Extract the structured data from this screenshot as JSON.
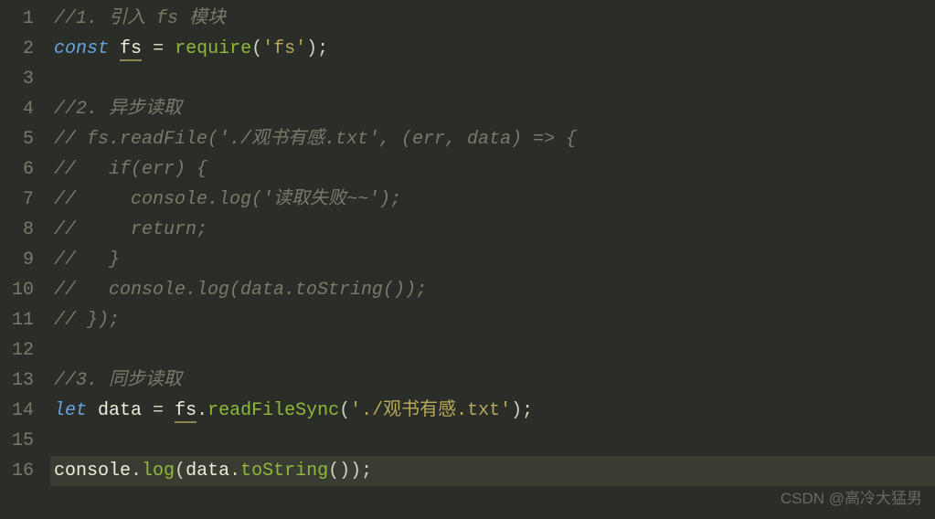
{
  "lines": [
    {
      "num": "1",
      "highlighted": false,
      "tokens": [
        {
          "cls": "tk-comment",
          "t": "//1. 引入 fs 模块"
        }
      ]
    },
    {
      "num": "2",
      "highlighted": false,
      "tokens": [
        {
          "cls": "tk-keyword",
          "t": "const"
        },
        {
          "cls": "tk-default",
          "t": " "
        },
        {
          "cls": "tk-var tk-warn",
          "t": "fs"
        },
        {
          "cls": "tk-default",
          "t": " "
        },
        {
          "cls": "tk-punct",
          "t": "="
        },
        {
          "cls": "tk-default",
          "t": " "
        },
        {
          "cls": "tk-func",
          "t": "require"
        },
        {
          "cls": "tk-punct",
          "t": "("
        },
        {
          "cls": "tk-string",
          "t": "'fs'"
        },
        {
          "cls": "tk-punct",
          "t": ");"
        }
      ]
    },
    {
      "num": "3",
      "highlighted": false,
      "tokens": []
    },
    {
      "num": "4",
      "highlighted": false,
      "tokens": [
        {
          "cls": "tk-comment",
          "t": "//2. 异步读取"
        }
      ]
    },
    {
      "num": "5",
      "highlighted": false,
      "tokens": [
        {
          "cls": "tk-comment",
          "t": "// fs.readFile('./观书有感.txt', (err, data) => {"
        }
      ]
    },
    {
      "num": "6",
      "highlighted": false,
      "tokens": [
        {
          "cls": "tk-comment",
          "t": "//   if(err) {"
        }
      ]
    },
    {
      "num": "7",
      "highlighted": false,
      "tokens": [
        {
          "cls": "tk-comment",
          "t": "//     console.log('读取失败~~');"
        }
      ]
    },
    {
      "num": "8",
      "highlighted": false,
      "tokens": [
        {
          "cls": "tk-comment",
          "t": "//     return;"
        }
      ]
    },
    {
      "num": "9",
      "highlighted": false,
      "tokens": [
        {
          "cls": "tk-comment",
          "t": "//   }"
        }
      ]
    },
    {
      "num": "10",
      "highlighted": false,
      "tokens": [
        {
          "cls": "tk-comment",
          "t": "//   console.log(data.toString());"
        }
      ]
    },
    {
      "num": "11",
      "highlighted": false,
      "tokens": [
        {
          "cls": "tk-comment",
          "t": "// });"
        }
      ]
    },
    {
      "num": "12",
      "highlighted": false,
      "tokens": []
    },
    {
      "num": "13",
      "highlighted": false,
      "tokens": [
        {
          "cls": "tk-comment",
          "t": "//3. 同步读取"
        }
      ]
    },
    {
      "num": "14",
      "highlighted": false,
      "tokens": [
        {
          "cls": "tk-keyword",
          "t": "let"
        },
        {
          "cls": "tk-default",
          "t": " data "
        },
        {
          "cls": "tk-punct",
          "t": "="
        },
        {
          "cls": "tk-default",
          "t": " "
        },
        {
          "cls": "tk-var tk-warn",
          "t": "fs"
        },
        {
          "cls": "tk-punct",
          "t": "."
        },
        {
          "cls": "tk-method",
          "t": "readFileSync"
        },
        {
          "cls": "tk-punct",
          "t": "("
        },
        {
          "cls": "tk-string",
          "t": "'./观书有感.txt'"
        },
        {
          "cls": "tk-punct",
          "t": ");"
        }
      ]
    },
    {
      "num": "15",
      "highlighted": false,
      "tokens": []
    },
    {
      "num": "16",
      "highlighted": true,
      "tokens": [
        {
          "cls": "tk-default",
          "t": "console"
        },
        {
          "cls": "tk-punct",
          "t": "."
        },
        {
          "cls": "tk-method",
          "t": "log"
        },
        {
          "cls": "tk-punct",
          "t": "("
        },
        {
          "cls": "tk-default",
          "t": "data"
        },
        {
          "cls": "tk-punct",
          "t": "."
        },
        {
          "cls": "tk-method",
          "t": "toString"
        },
        {
          "cls": "tk-punct",
          "t": "());"
        }
      ]
    }
  ],
  "watermark": "CSDN @高冷大猛男"
}
